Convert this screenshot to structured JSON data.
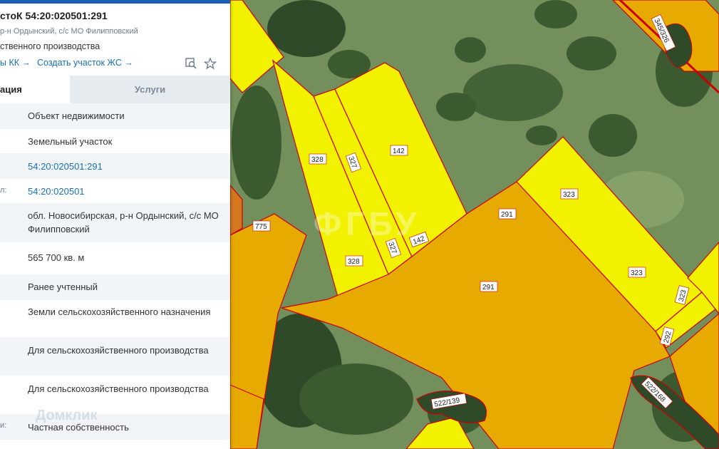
{
  "panel": {
    "title": "стоК 54:20:020501:291",
    "address_short": "р-н Ордынский, с/с МО Филипповский",
    "purpose_short": "ственного производства",
    "link_kk": "ы КК →",
    "link_create": "Создать участок ЖС →",
    "tabs": [
      {
        "label": "ация"
      },
      {
        "label": "Услуги"
      }
    ],
    "rows": [
      {
        "label": "",
        "value": "Объект недвижимости"
      },
      {
        "label": "",
        "value": "Земельный участок"
      },
      {
        "label": "",
        "value": "54:20:020501:291"
      },
      {
        "label": "л:",
        "value": "54:20:020501"
      },
      {
        "label": "",
        "value": "обл. Новосибирская, р-н Ордынский, с/с МО Филипповский"
      },
      {
        "label": "",
        "value": "565 700 кв. м"
      },
      {
        "label": "",
        "value": "Ранее учтенный"
      },
      {
        "label": "",
        "value": "Земли сельскохозяйственного назначения"
      },
      {
        "label": "",
        "value": "Для сельскохозяйственного производства"
      },
      {
        "label": "",
        "value": "Для сельскохозяйственного производства"
      },
      {
        "label": "и:",
        "value": "Частная собственность"
      }
    ],
    "watermark": "Домклик"
  },
  "map": {
    "parcel_labels": [
      "328",
      "327",
      "142",
      "328",
      "327",
      "142",
      "291",
      "291",
      "323",
      "323",
      "323",
      "292",
      "775",
      "345/326",
      "522/139",
      "522/168"
    ],
    "colors": {
      "selected": "#e6aa00",
      "parcel": "#f2f200",
      "border": "#cc0000",
      "satellite": "#6f8a5a",
      "forest": "#2f4a28"
    }
  }
}
